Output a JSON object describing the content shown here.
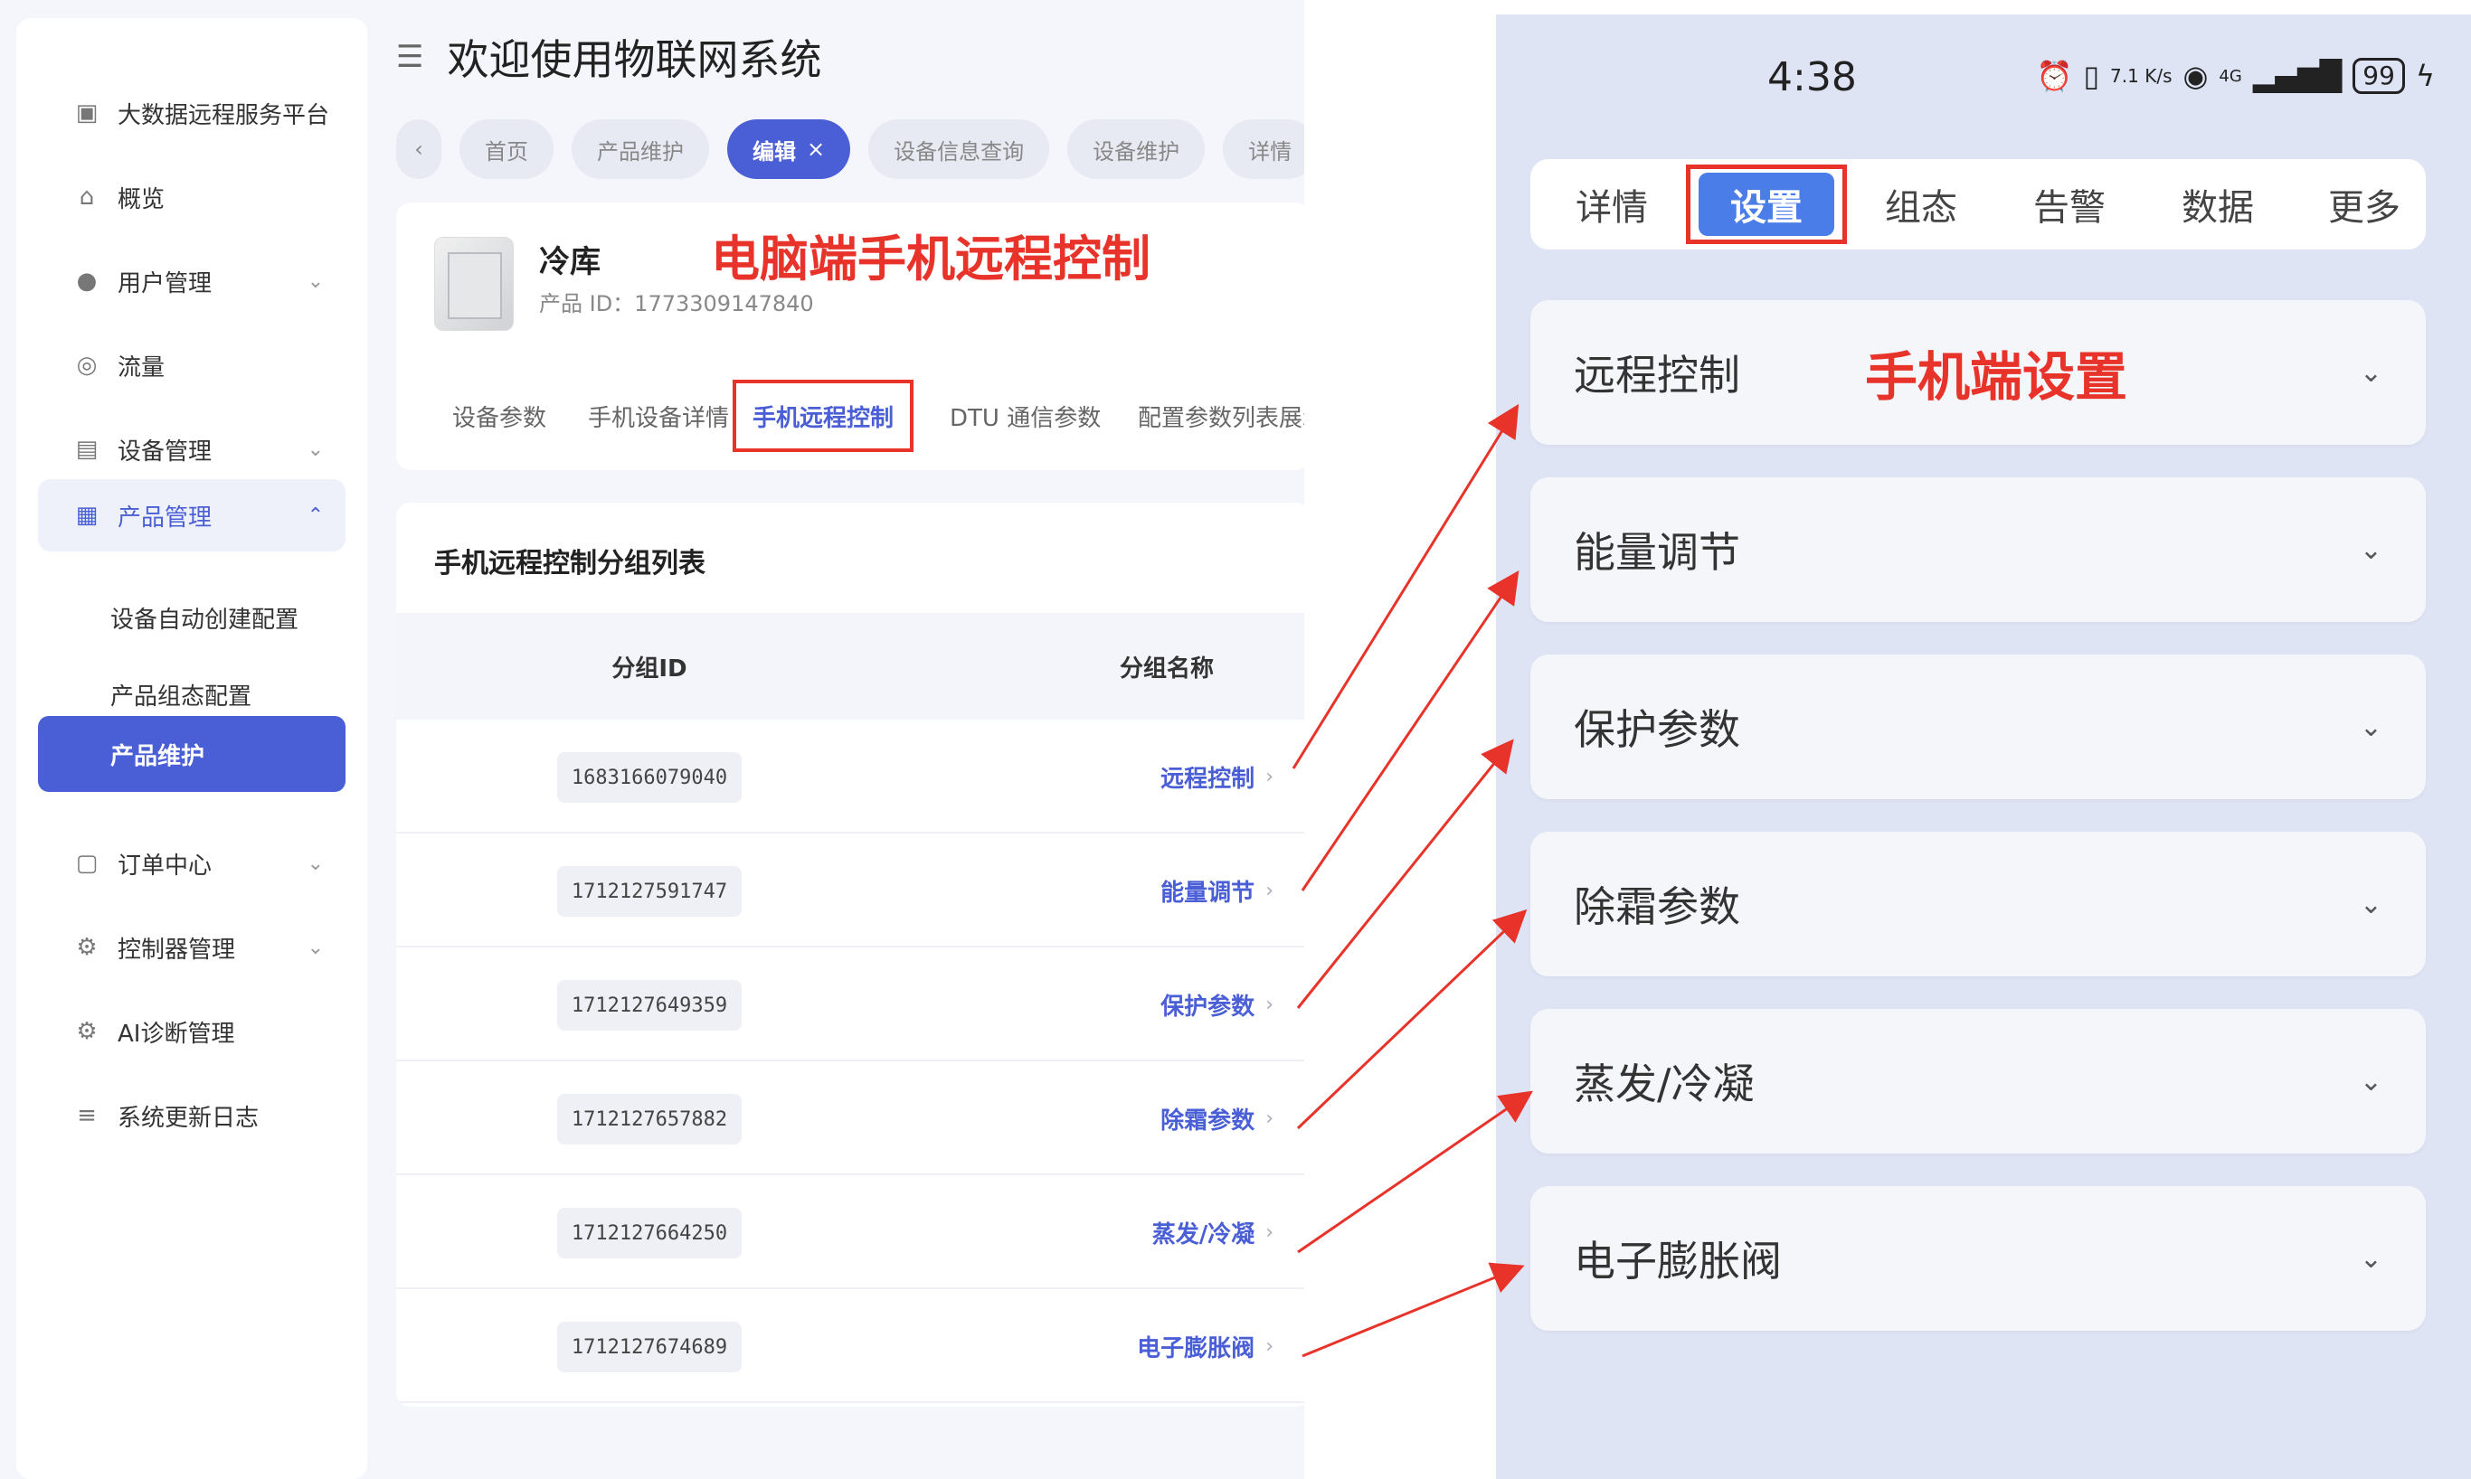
{
  "desktop": {
    "sidebar": {
      "items": [
        {
          "label": "大数据远程服务平台",
          "icon": "monitor-icon"
        },
        {
          "label": "概览",
          "icon": "home-icon"
        },
        {
          "label": "用户管理",
          "icon": "user-icon",
          "expandable": true
        },
        {
          "label": "流量",
          "icon": "traffic-icon"
        },
        {
          "label": "设备管理",
          "icon": "device-icon",
          "expandable": true
        },
        {
          "label": "产品管理",
          "icon": "product-icon",
          "expanded": true
        },
        {
          "label": "订单中心",
          "icon": "clipboard-icon",
          "expandable": true
        },
        {
          "label": "控制器管理",
          "icon": "gear-icon",
          "expandable": true
        },
        {
          "label": "AI诊断管理",
          "icon": "gear-icon"
        },
        {
          "label": "系统更新日志",
          "icon": "log-icon"
        }
      ],
      "sub_items": [
        {
          "label": "设备自动创建配置"
        },
        {
          "label": "产品组态配置"
        },
        {
          "label": "产品维护",
          "active": true
        }
      ]
    },
    "header": {
      "title": "欢迎使用物联网系统"
    },
    "tabs": [
      {
        "label": "首页"
      },
      {
        "label": "产品维护"
      },
      {
        "label": "编辑",
        "active": true,
        "close": "×"
      },
      {
        "label": "设备信息查询"
      },
      {
        "label": "设备维护"
      },
      {
        "label": "详情"
      }
    ],
    "product": {
      "name": "冷库",
      "id_text": "产品 ID：1773309147840",
      "annotation": "电脑端手机远程控制"
    },
    "subtabs": [
      {
        "label": "设备参数"
      },
      {
        "label": "手机设备详情"
      },
      {
        "label": "手机远程控制",
        "active": true
      },
      {
        "label": "DTU 通信参数"
      },
      {
        "label": "配置参数列表展示"
      }
    ],
    "list": {
      "title": "手机远程控制分组列表",
      "col_id": "分组ID",
      "col_name": "分组名称",
      "rows": [
        {
          "id": "1683166079040",
          "name": "远程控制"
        },
        {
          "id": "1712127591747",
          "name": "能量调节"
        },
        {
          "id": "1712127649359",
          "name": "保护参数"
        },
        {
          "id": "1712127657882",
          "name": "除霜参数"
        },
        {
          "id": "1712127664250",
          "name": "蒸发/冷凝"
        },
        {
          "id": "1712127674689",
          "name": "电子膨胀阀"
        }
      ]
    }
  },
  "phone": {
    "status": {
      "time": "4:38",
      "speed": "7.1 K/s",
      "network": "4G",
      "battery": "99"
    },
    "tabs": [
      {
        "label": "详情"
      },
      {
        "label": "设置",
        "active": true
      },
      {
        "label": "组态"
      },
      {
        "label": "告警"
      },
      {
        "label": "数据"
      },
      {
        "label": "更多"
      }
    ],
    "annotation": "手机端设置",
    "sections": [
      {
        "label": "远程控制"
      },
      {
        "label": "能量调节"
      },
      {
        "label": "保护参数"
      },
      {
        "label": "除霜参数"
      },
      {
        "label": "蒸发/冷凝"
      },
      {
        "label": "电子膨胀阀"
      }
    ]
  },
  "colors": {
    "accent": "#4a5fd6",
    "annotation_red": "#e8332a",
    "phone_bg": "#dfe4f5"
  }
}
